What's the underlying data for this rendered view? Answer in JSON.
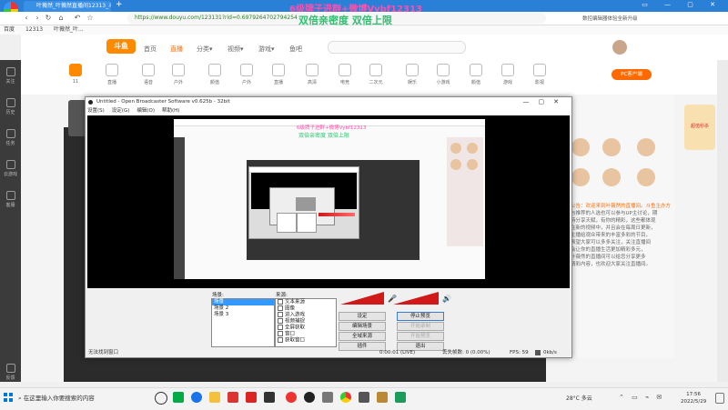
{
  "browser": {
    "tab_title": "叶薇然_叶薇然直播间12313_斗...",
    "url": "https://www.douyu.com/123131?rid=0.6979264702794254",
    "bookmarks": [
      "百度",
      "12313",
      "叶薇然_叶..."
    ],
    "right_hint": "数控编辑器体验全新升级",
    "nav_icons": [
      "back-icon",
      "forward-icon",
      "reload-icon",
      "home-icon",
      "undo-icon",
      "star-icon"
    ]
  },
  "promo": {
    "line1": "6级牌子进群+微博Vybf12313",
    "line2": "双倍亲密度  双倍上限"
  },
  "douyu": {
    "logo": "斗鱼",
    "nav": [
      "首页",
      "直播",
      "分类▾",
      "视频▾",
      "游戏▾",
      "鱼吧"
    ],
    "left_rail": [
      "关注",
      "历史",
      "任务",
      "云游戏",
      "客服",
      "反馈"
    ],
    "categories": [
      "11",
      "直播",
      "语音",
      "户外",
      "颜值",
      "户外",
      "直播",
      "高清",
      "电竞",
      "二次元",
      "娱乐",
      "小游戏",
      "颜值",
      "游戏",
      "影视",
      "PC客户端"
    ],
    "right_text": [
      "叶薇然",
      "公告：欢迎来到叶薇然的直播间。斗鱼主办方",
      "与推荐的人选也可以参与UP主讨论，期",
      "待分享天赋，有你的精彩，这些都体现",
      "在新的视频中，并且会在每周日更新，",
      "主播给观众带来的丰富多彩的节目，",
      "希望大家可以多多关注，关注直播间",
      "会让你的直播生活更加精彩多元，",
      "叶薇然的直播间可以给您分享更多",
      "精彩内容，也欢迎大家关注直播间。"
    ],
    "side_ad": "超值秒杀"
  },
  "obs": {
    "title": "Untitled - Open Broadcaster Software v0.625b - 32bit",
    "menu": [
      "设置(S)",
      "设定(G)",
      "编辑(O)",
      "帮助(H)"
    ],
    "scene_header": "场景:",
    "source_header": "来源:",
    "scenes": [
      "场景",
      "场景 2",
      "场景 3"
    ],
    "sources": [
      "文本来源",
      "图像",
      "进入游戏",
      "视频捕捉",
      "全屏获取",
      "窗口",
      "获取窗口"
    ],
    "buttons": {
      "settings": "设定",
      "stop_preview": "停止预览",
      "edit_scene": "编辑场景",
      "start_record": "开始录制",
      "global_sources": "全域来源",
      "plugins": "插件",
      "exit": "退出",
      "preview_disabled": "开始预览"
    },
    "status_left": "无法找到窗口",
    "status_time": "0:00:01 (LIVE)",
    "status_dropped": "丢失帧数: 0 (0.00%)",
    "status_fps": "FPS: 59",
    "status_kbps": "0kb/s"
  },
  "taskbar": {
    "search_placeholder": "在这里输入你要搜索的内容",
    "weather": "28°C 多云",
    "time": "17:56",
    "date": "2022/5/29"
  },
  "colors": {
    "browser_blue": "#2a7fd6",
    "promo_pink": "#ff4fae",
    "promo_green": "#2cc06e",
    "douyu_orange": "#ff8a00",
    "meter_red": "#d11919"
  }
}
